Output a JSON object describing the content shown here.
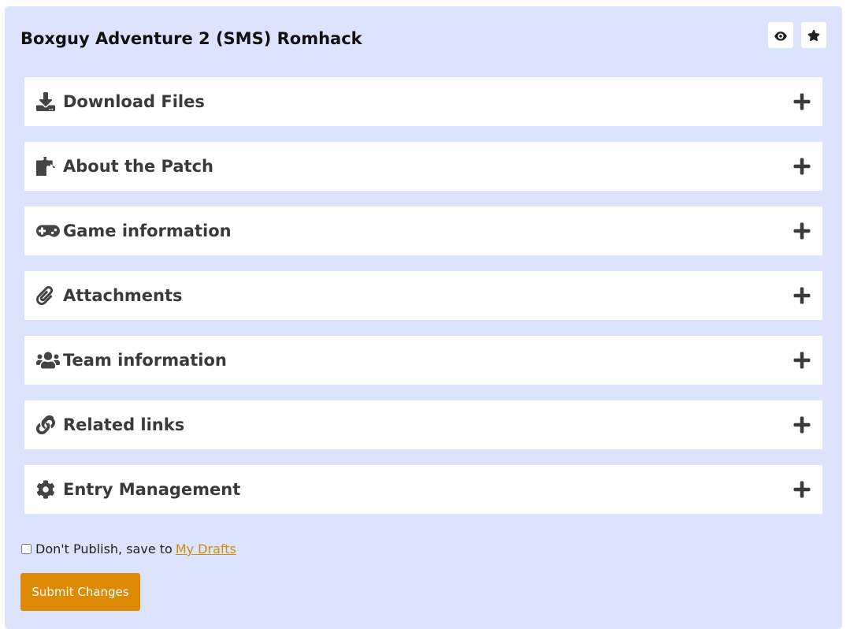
{
  "header": {
    "title": "Boxguy Adventure 2 (SMS) Romhack",
    "watch_icon": "eye-icon",
    "favorite_icon": "star-icon"
  },
  "sections": [
    {
      "label": "Download Files",
      "icon": "download-icon"
    },
    {
      "label": "About the Patch",
      "icon": "puzzle-piece-icon"
    },
    {
      "label": "Game information",
      "icon": "gamepad-icon"
    },
    {
      "label": "Attachments",
      "icon": "paperclip-icon"
    },
    {
      "label": "Team information",
      "icon": "users-icon"
    },
    {
      "label": "Related links",
      "icon": "link-icon"
    },
    {
      "label": "Entry Management",
      "icon": "gear-icon"
    }
  ],
  "footer": {
    "draft_label": "Don't Publish, save to",
    "draft_link": "My Drafts",
    "draft_checked": false,
    "submit_label": "Submit Changes"
  },
  "colors": {
    "panel_bg": "#dce3fd",
    "accent": "#dd8a07",
    "link": "#d28b0f"
  }
}
